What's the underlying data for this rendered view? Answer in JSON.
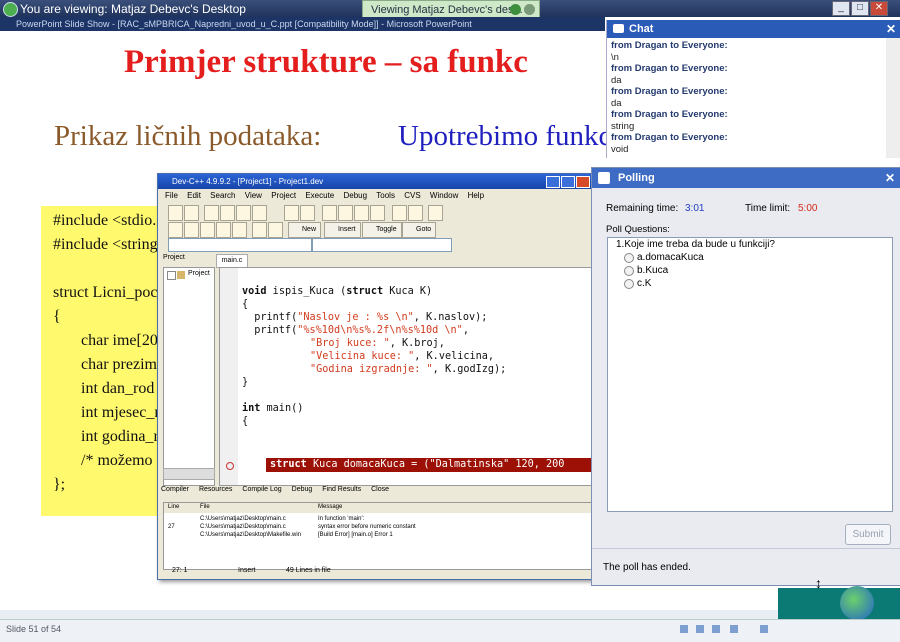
{
  "viewer": {
    "title": "You are viewing: Matjaz Debevc's Desktop",
    "notification": "Viewing Matjaz Debevc's des..."
  },
  "ppt": {
    "window_title": "PowerPoint Slide Show - [RAC_sMPBRICA_Napredni_uvod_u_C.ppt [Compatibility Mode]] - Microsoft PowerPoint",
    "slide_title": "Primjer strukture – sa funkc",
    "subtitle_left": "Prikaz ličnih podataka:",
    "subtitle_right": "Upotrebimo funkc",
    "code_lines": [
      "#include <stdio.",
      "#include <string",
      "",
      "struct Licni_poc",
      "{",
      "char ime[20",
      "char prezim",
      "int dan_rod",
      "int mjesec_r",
      "int godina_r",
      "/* možemo",
      "};"
    ],
    "slide_number": "Slide 51 of 54"
  },
  "devcpp": {
    "title": "Dev-C++ 4.9.9.2 - [Project1] - Project1.dev",
    "menu": [
      "File",
      "Edit",
      "Search",
      "View",
      "Project",
      "Execute",
      "Debug",
      "Tools",
      "CVS",
      "Window",
      "Help"
    ],
    "toolbar": {
      "new": "New",
      "insert": "Insert",
      "toggle": "Toggle",
      "goto": "Goto"
    },
    "project_tab": "Project",
    "project_item": "Project",
    "file_tab": "main.c",
    "bottom_tabs": [
      "Compiler",
      "Resources",
      "Compile Log",
      "Debug",
      "Find Results",
      "Close"
    ],
    "messages_header": {
      "line": "Line",
      "file": "File",
      "message": "Message"
    },
    "messages": [
      {
        "line": "",
        "file": "C:\\Users\\matjaz\\Desktop\\main.c",
        "message": "In function 'main':"
      },
      {
        "line": "27",
        "file": "C:\\Users\\matjaz\\Desktop\\main.c",
        "message": "syntax error before numeric constant"
      },
      {
        "line": "",
        "file": "C:\\Users\\matjaz\\Desktop\\Makefile.win",
        "message": "[Build Error]  [main.o] Error 1"
      }
    ],
    "status": {
      "pos": "27: 1",
      "mode": "Insert",
      "lines": "49 Lines in file"
    }
  },
  "code": {
    "l1_kw": "void",
    "l1_rest": " ispis_Kuca (",
    "l1_kw2": "struct",
    "l1_tail": " Kuca K)",
    "l2": "{",
    "l3_a": "  printf(",
    "l3_s": "\"Naslov je : %s \\n\"",
    "l3_b": ", K.naslov);",
    "l4_a": "  printf(",
    "l4_s": "\"%s%10d\\n%s%.2f\\n%s%10d \\n\"",
    "l4_b": ",",
    "l5_s": "\"Broj kuce: \"",
    "l5_b": ", K.broj,",
    "l6_s": "\"Velicina kuce: \"",
    "l6_b": ", K.velicina,",
    "l7_s": "\"Godina izgradnje: \"",
    "l7_b": ", K.godIzg);",
    "l8": "}",
    "l9_kw": "int",
    "l9_rest": " main()",
    "l10": "{",
    "err_kw": "struct",
    "err_rest": " Kuca domacaKuca = (\"Dalmatinska\" 120, 200"
  },
  "chat": {
    "title": "Chat",
    "messages": [
      {
        "from": "from Dragan to Everyone:",
        "text": "\\n"
      },
      {
        "from": "from Dragan to Everyone:",
        "text": "da"
      },
      {
        "from": "from Dragan to Everyone:",
        "text": "da"
      },
      {
        "from": "from Dragan to Everyone:",
        "text": "string"
      },
      {
        "from": "from Dragan to Everyone:",
        "text": "void"
      }
    ]
  },
  "polling": {
    "title": "Polling",
    "remaining_label": "Remaining time:",
    "remaining_value": "3:01",
    "limit_label": "Time limit:",
    "limit_value": "5:00",
    "questions_label": "Poll Questions:",
    "question": "1.Koje ime treba da bude u funkciji?",
    "options": [
      "a.domacaKuca",
      "b.Kuca",
      "c.K"
    ],
    "submit": "Submit",
    "status": "The poll has ended."
  },
  "colors": {
    "accent": "#2a5bb6",
    "title_red": "#e41d1d",
    "error_bg": "#9c1006",
    "remaining_blue": "#1f3fbf",
    "limit_red": "#d32a1a"
  }
}
